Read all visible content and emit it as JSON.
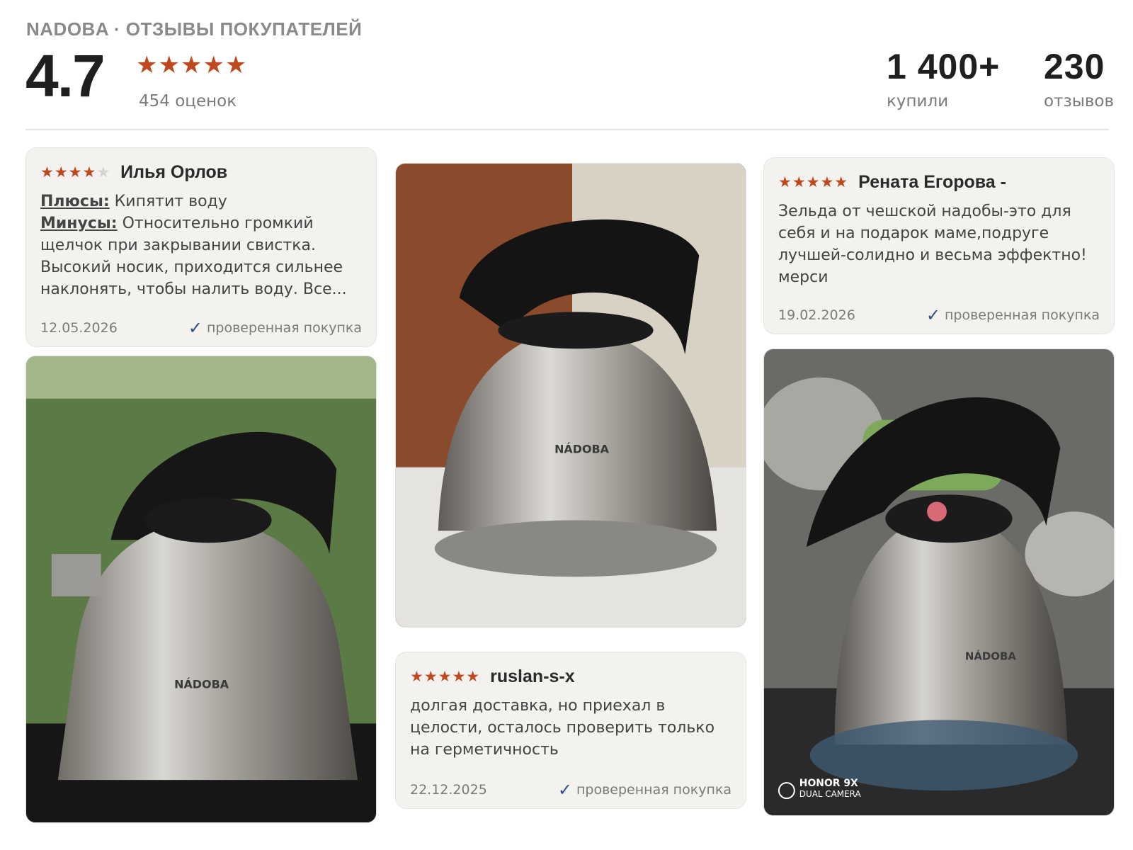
{
  "header": {
    "brand": "NADOBA · ОТЗЫВЫ ПОКУПАТЕЛЕЙ",
    "rating": "4.7",
    "stars": "★★★★★",
    "ratings_count": "454 оценок",
    "bought_value": "1 400+",
    "bought_label": "купили",
    "reviews_value": "230",
    "reviews_label": "отзывов"
  },
  "reviews": [
    {
      "rating": 4,
      "stars_on": "★★★★",
      "stars_off": "★",
      "author": "Илья Орлов",
      "pros_label": "Плюсы:",
      "pros": " Кипятит воду",
      "cons_label": "Минусы:",
      "cons": " Относительно громкий щелчок при закрывании свистка. Высокий носик, приходится сильнее наклонять, чтобы налить воду. Все...",
      "date": "12.05.2026",
      "verified": "проверенная покупка"
    },
    {
      "rating": 5,
      "stars_on": "★★★★★",
      "author": "ruslan-s-x",
      "text": "долгая доставка, но приехал в целости, осталось проверить только на герметичность",
      "date": "22.12.2025",
      "verified": "проверенная покупка"
    },
    {
      "rating": 5,
      "stars_on": "★★★★★",
      "author": "Рената Егорова -",
      "text": "Зельда от чешской надобы-это для себя и на подарок маме,подруге лучшей-солидно и весьма эффектно!мерси",
      "date": "19.02.2026",
      "verified": "проверенная покупка"
    }
  ],
  "photos": [
    {
      "kettle_logo": "NÁDOBA",
      "background": "#5c7a45"
    },
    {
      "kettle_logo": "NÁDOBA",
      "background": "#8a4a2c"
    },
    {
      "kettle_logo": "NÁDOBA",
      "background": "#6a6a66",
      "watermark": "HONOR 9X",
      "watermark_sub": "DUAL CAMERA"
    }
  ],
  "colors": {
    "star": "#c0481e",
    "star_off": "#d4d4d4",
    "check": "#2d4b84",
    "card_bg": "#f3f2ef"
  },
  "icons": [
    "star-icon",
    "check-icon",
    "camera-watermark-icon"
  ]
}
